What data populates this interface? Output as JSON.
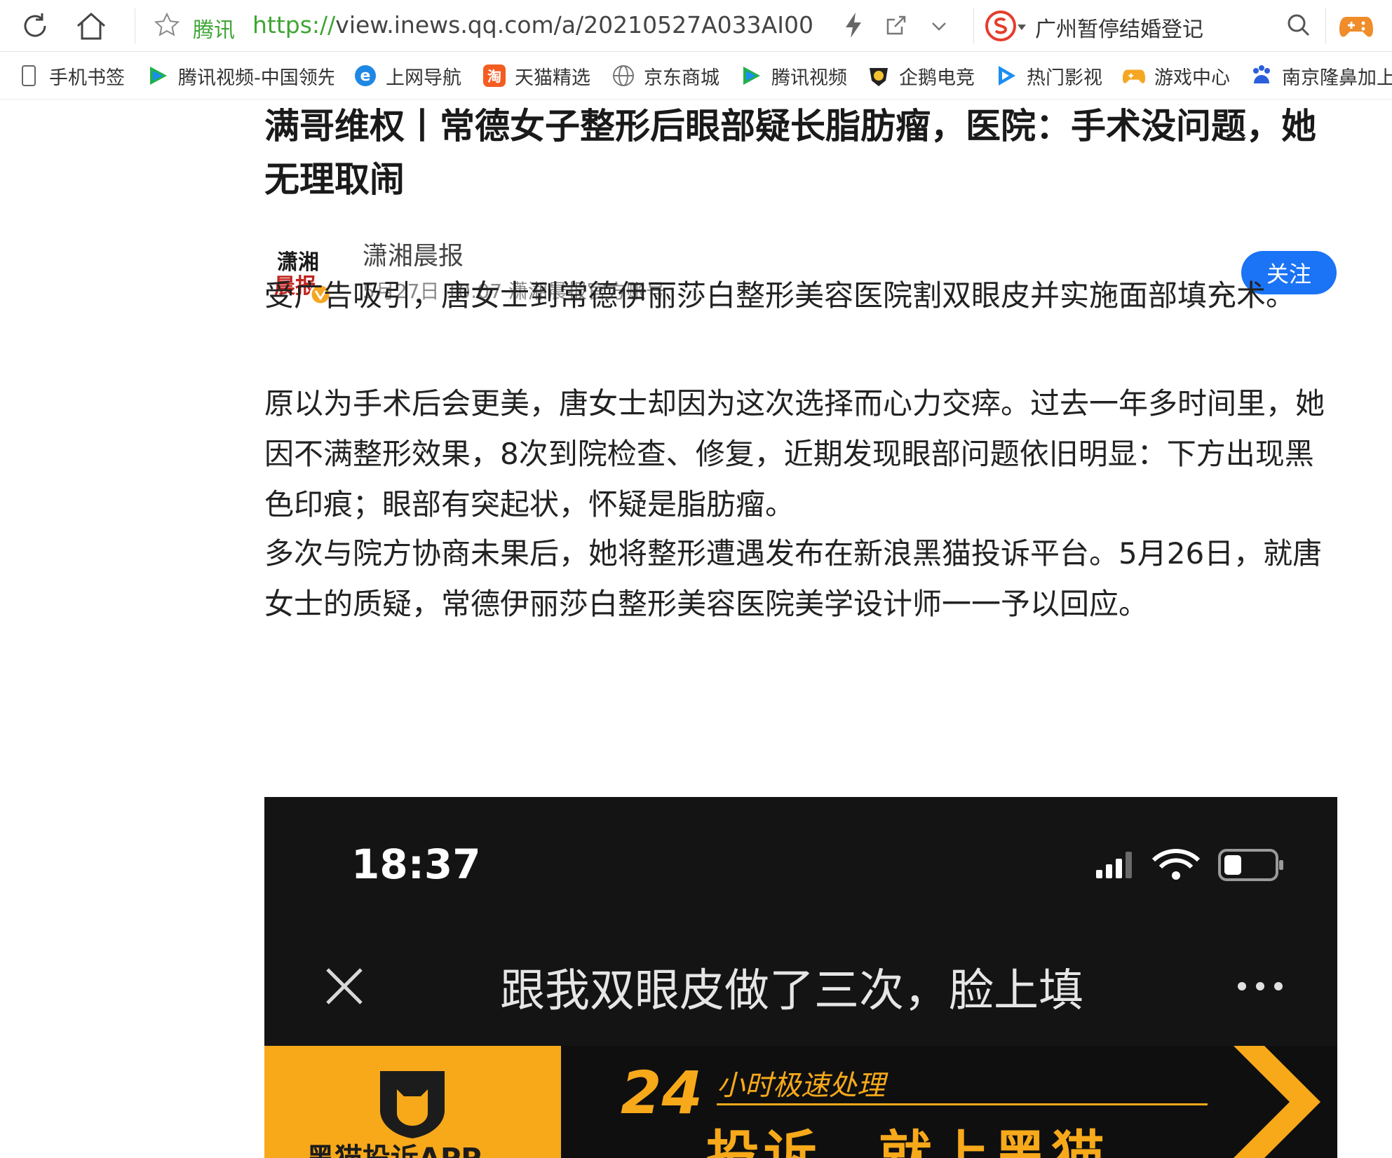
{
  "browser": {
    "site_name": "腾讯",
    "url_scheme": "https://",
    "url_rest": "view.inews.qq.com/a/20210527A033AI00",
    "search_text": "广州暂停结婚登记",
    "bookmarks": [
      {
        "label": "手机书签",
        "icon": "phone-icon"
      },
      {
        "label": "腾讯视频-中国领先",
        "icon": "tencent-video-icon"
      },
      {
        "label": "上网导航",
        "icon": "ie-icon"
      },
      {
        "label": "天猫精选",
        "icon": "taobao-icon"
      },
      {
        "label": "京东商城",
        "icon": "globe-icon"
      },
      {
        "label": "腾讯视频",
        "icon": "tencent-video-icon"
      },
      {
        "label": "企鹅电竞",
        "icon": "penguin-esports-icon"
      },
      {
        "label": "热门影视",
        "icon": "video-play-icon"
      },
      {
        "label": "游戏中心",
        "icon": "game-center-icon"
      },
      {
        "label": "南京隆鼻加上",
        "icon": "baidu-icon"
      }
    ]
  },
  "article": {
    "title": "满哥维权丨常德女子整形后眼部疑长脂肪瘤，医院：手术没问题，她无理取闹",
    "author": {
      "name": "潇湘晨报",
      "meta": "5月27日 10:07 潇湘晨报官方账号",
      "logo_text": "潇湘晨报"
    },
    "follow_label": "关注",
    "paragraphs": [
      "受广告吸引，唐女士到常德伊丽莎白整形美容医院割双眼皮并实施面部填充术。",
      "原以为手术后会更美，唐女士却因为这次选择而心力交瘁。过去一年多时间里，她因不满整形效果，8次到院检查、修复，近期发现眼部问题依旧明显：下方出现黑色印痕；眼部有突起状，怀疑是脂肪瘤。",
      "多次与院方协商未果后，她将整形遭遇发布在新浪黑猫投诉平台。5月26日，就唐女士的质疑，常德伊丽莎白整形美容医院美学设计师一一予以回应。"
    ]
  },
  "embedded_screenshot": {
    "time": "18:37",
    "page_title": "跟我双眼皮做了三次，脸上填",
    "app_name": "黑猫投诉APP",
    "banner_number": "24",
    "banner_tagline": "小时极速处理",
    "banner_slogan": "投诉，就上黑猫",
    "colors": {
      "accent": "#f7a91a",
      "background": "#141414"
    }
  },
  "colors": {
    "link_green": "#3fa535",
    "follow_blue": "#1b73f5"
  }
}
